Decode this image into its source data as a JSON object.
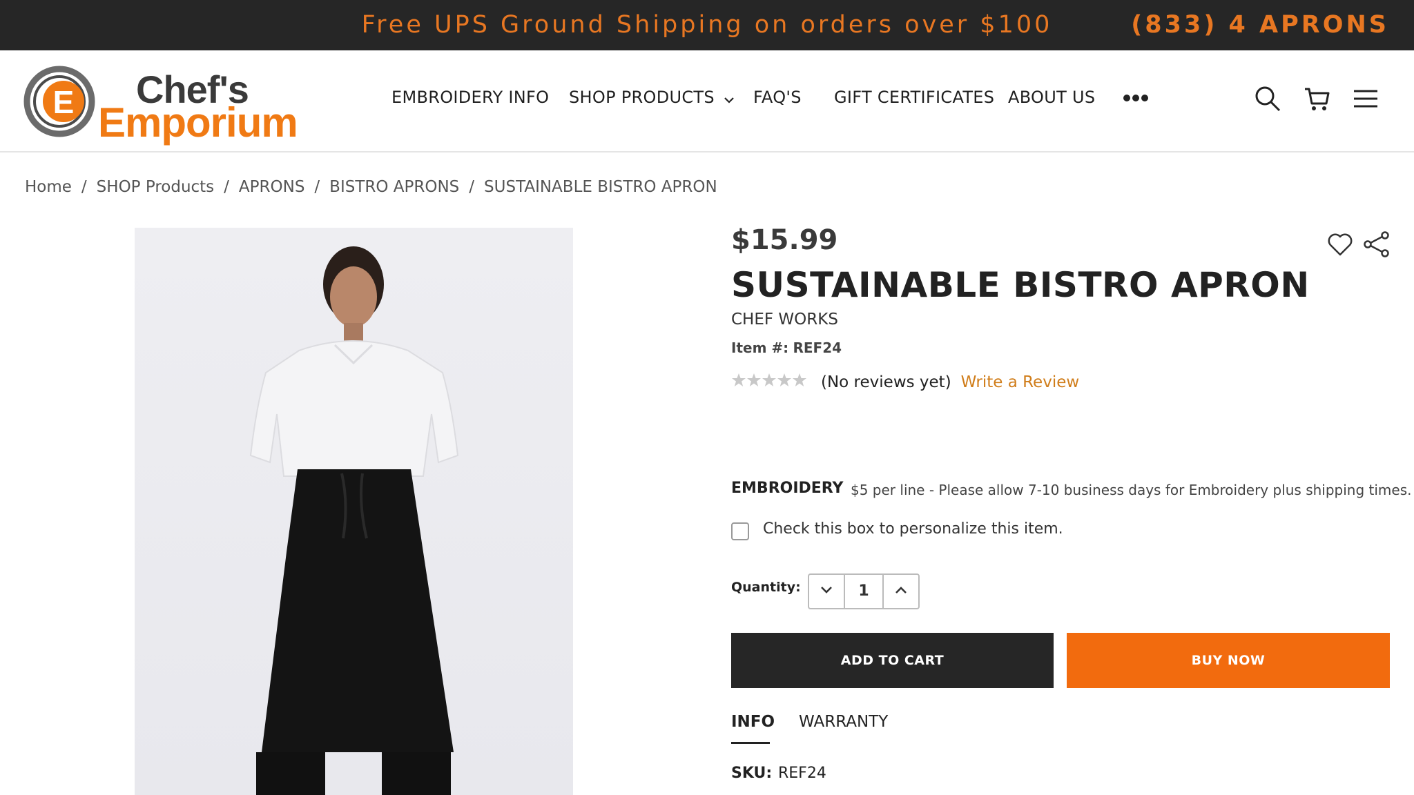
{
  "topbar": {
    "promo": "Free UPS Ground Shipping on orders over $100",
    "phone": "(833) 4 APRONS"
  },
  "logo": {
    "line1": "Chef's",
    "line2": "Emporium",
    "mark": "E"
  },
  "nav": {
    "items": [
      "EMBROIDERY INFO",
      "SHOP PRODUCTS",
      "FAQ'S",
      "GIFT CERTIFICATES",
      "ABOUT US"
    ]
  },
  "breadcrumb": [
    "Home",
    "SHOP Products",
    "APRONS",
    "BISTRO APRONS",
    "SUSTAINABLE BISTRO APRON"
  ],
  "product": {
    "price": "$15.99",
    "title": "SUSTAINABLE BISTRO APRON",
    "brand": "CHEF WORKS",
    "item_label": "Item #:",
    "item_no": "REF24",
    "rating": 0,
    "rating_max": 5,
    "reviews_text": "(No reviews yet)",
    "write_review": "Write a Review",
    "embroidery_label": "EMBROIDERY",
    "embroidery_note": "$5 per line - Please allow 7-10 business days for Embroidery plus shipping times.",
    "personalize_label": "Check this box to personalize this item.",
    "personalize_checked": false,
    "quantity_label": "Quantity:",
    "quantity": "1",
    "add_to_cart": "ADD TO CART",
    "buy_now": "BUY NOW",
    "tabs": [
      "INFO",
      "WARRANTY"
    ],
    "sku_label": "SKU:",
    "sku": "REF24"
  },
  "colors": {
    "accent": "#f26b0e",
    "topbar_bg": "#262626",
    "dark_button": "#262626"
  },
  "icons": [
    "search-icon",
    "cart-icon",
    "hamburger-menu-icon",
    "chevron-down-icon",
    "more-dots-icon",
    "heart-icon",
    "share-icon",
    "star-icon"
  ]
}
